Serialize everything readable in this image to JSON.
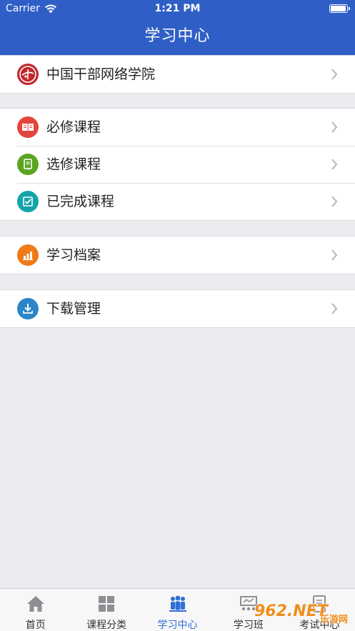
{
  "status_bar": {
    "carrier": "Carrier",
    "time": "1:21 PM",
    "battery_level": 1.0
  },
  "nav": {
    "title": "学习中心"
  },
  "groups": [
    {
      "items": [
        {
          "label": "中国干部网络学院",
          "icon": "academy-logo-icon",
          "color": "#c1282d"
        }
      ]
    },
    {
      "items": [
        {
          "label": "必修课程",
          "icon": "book-icon",
          "color": "#e2453b"
        },
        {
          "label": "选修课程",
          "icon": "document-icon",
          "color": "#5aa51f"
        },
        {
          "label": "已完成课程",
          "icon": "checkbox-icon",
          "color": "#13a4a8"
        }
      ]
    },
    {
      "items": [
        {
          "label": "学习档案",
          "icon": "bar-chart-icon",
          "color": "#f07a1a"
        }
      ]
    },
    {
      "items": [
        {
          "label": "下载管理",
          "icon": "download-icon",
          "color": "#2a86c8"
        }
      ]
    }
  ],
  "tabs": [
    {
      "label": "首页",
      "icon": "home-icon"
    },
    {
      "label": "课程分类",
      "icon": "grid-icon"
    },
    {
      "label": "学习中心",
      "icon": "people-icon",
      "active": true
    },
    {
      "label": "学习班",
      "icon": "classroom-icon"
    },
    {
      "label": "考试中心",
      "icon": "exam-icon"
    }
  ],
  "colors": {
    "primary": "#2f5fc6",
    "active_tab": "#2f6fd6",
    "background": "#ebebf0"
  },
  "watermark": {
    "text": "962.NET",
    "sub": "乐游网"
  }
}
